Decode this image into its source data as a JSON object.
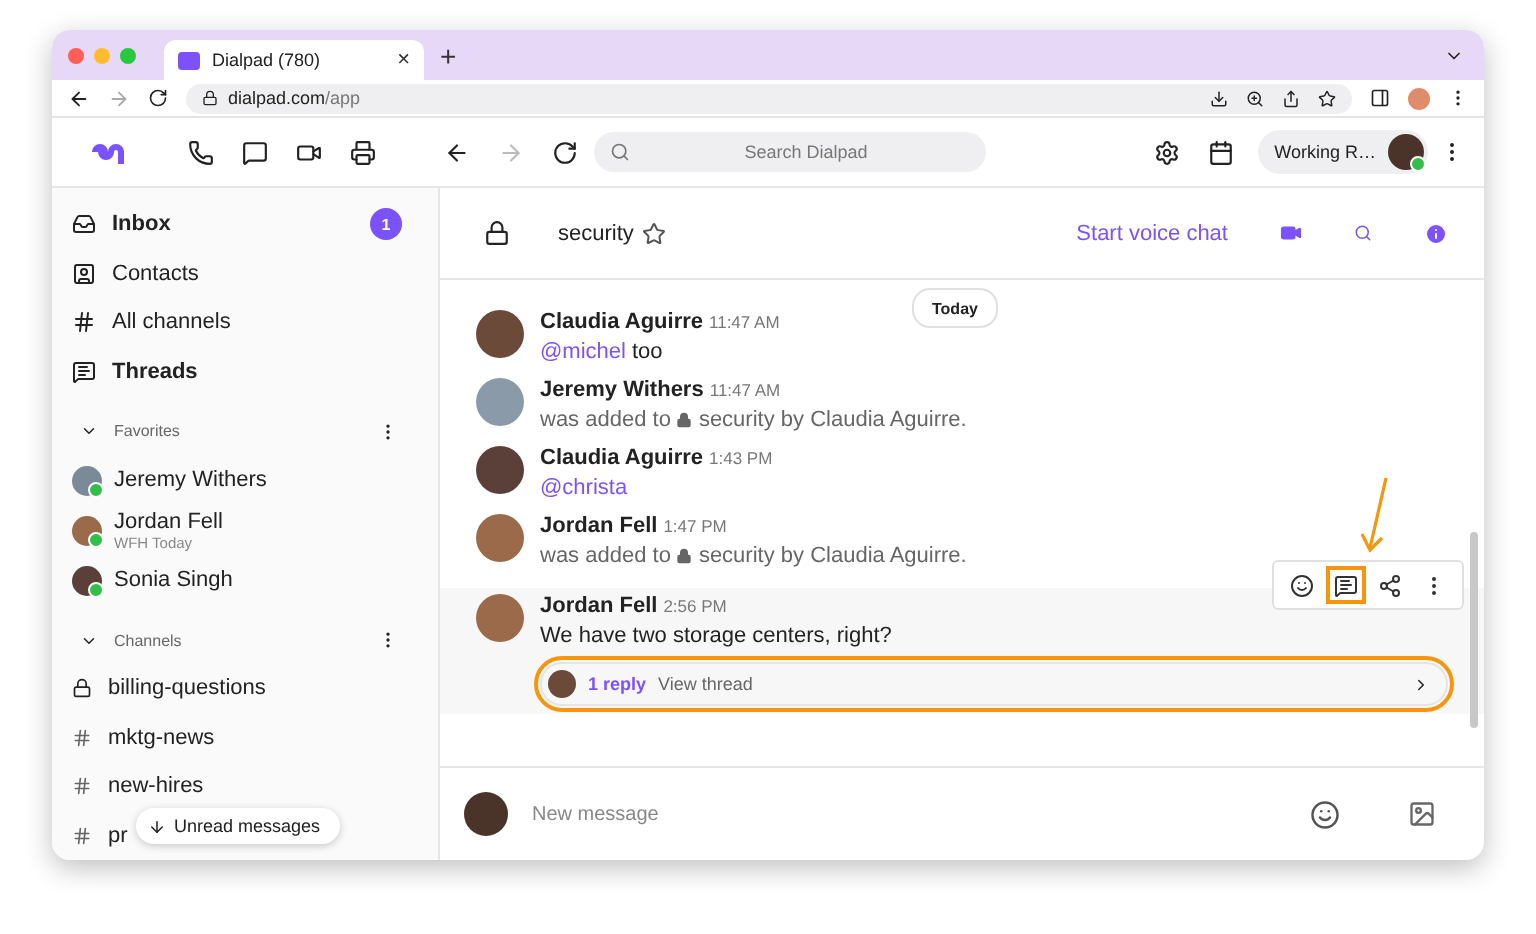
{
  "browser": {
    "tab_title": "Dialpad (780)",
    "tab_close": "×",
    "new_tab": "+",
    "url_host": "dialpad.com",
    "url_path": "/app"
  },
  "toolbar": {
    "search_placeholder": "Search Dialpad",
    "status": "Working R…"
  },
  "sidebar": {
    "nav": [
      {
        "kind": "inbox",
        "label": "Inbox",
        "unread": true,
        "badge": "1"
      },
      {
        "kind": "contacts",
        "label": "Contacts",
        "unread": false
      },
      {
        "kind": "channels",
        "label": "All channels",
        "unread": false
      },
      {
        "kind": "threads",
        "label": "Threads",
        "unread": true
      }
    ],
    "favorites": {
      "title": "Favorites",
      "expanded": true,
      "contacts": [
        {
          "name": "Jeremy Withers",
          "online": true
        },
        {
          "name": "Jordan Fell",
          "status": "WFH Today",
          "online": true
        },
        {
          "name": "Sonia Singh",
          "online": true
        }
      ]
    },
    "channels": {
      "title": "Channels",
      "expanded": true,
      "items": [
        {
          "name": "billing-questions",
          "private": true
        },
        {
          "name": "mktg-news",
          "private": false
        },
        {
          "name": "new-hires",
          "private": false
        },
        {
          "name": "pr",
          "private": false
        }
      ]
    },
    "unread_pill": "Unread messages"
  },
  "channel": {
    "name": "security",
    "private": true,
    "starred": false,
    "voice_chat": "Start voice chat"
  },
  "date_divider": "Today",
  "messages": [
    {
      "author": "Claudia Aguirre",
      "time": "11:47 AM",
      "kind": "mention",
      "mention": "@michel",
      "text": "too"
    },
    {
      "author": "Jeremy Withers",
      "time": "11:47 AM",
      "kind": "added",
      "before": "was added to",
      "channel": "security",
      "after": "by Claudia Aguirre."
    },
    {
      "author": "Claudia Aguirre",
      "time": "1:43 PM",
      "kind": "mention",
      "mention": "@christa"
    },
    {
      "author": "Jordan Fell",
      "time": "1:47 PM",
      "kind": "added",
      "before": "was added to",
      "channel": "security",
      "after": "by Claudia Aguirre."
    },
    {
      "author": "Jordan Fell",
      "time": "2:56 PM",
      "kind": "text",
      "text": "We have two storage centers, right?",
      "hovered": true,
      "thread": {
        "replies": "1 reply",
        "link": "View thread",
        "highlighted": true
      },
      "actions": [
        {
          "kind": "emoji",
          "highlighted": false
        },
        {
          "kind": "thread",
          "highlighted": true
        },
        {
          "kind": "share",
          "highlighted": false
        },
        {
          "kind": "more",
          "highlighted": false
        }
      ]
    }
  ],
  "composer": {
    "placeholder": "New message"
  }
}
